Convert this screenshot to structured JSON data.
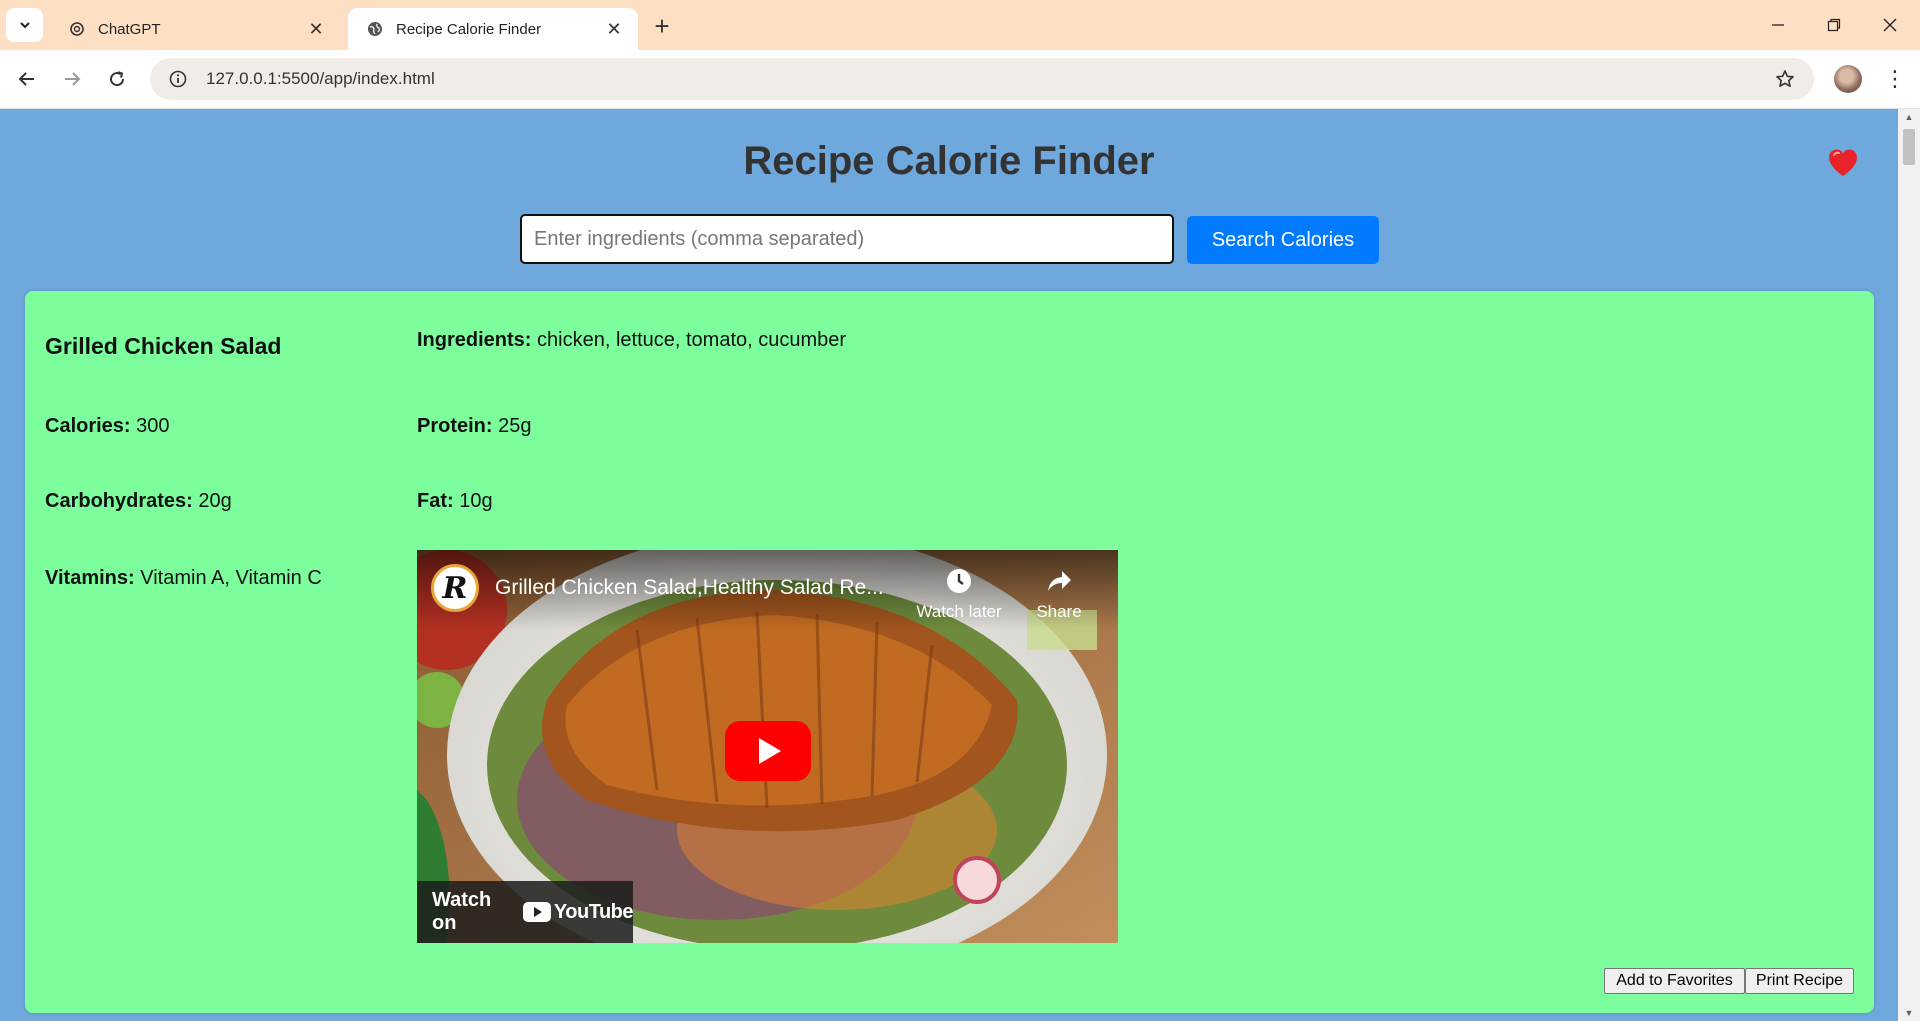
{
  "browser": {
    "tabs": [
      {
        "title": "ChatGPT",
        "active": false
      },
      {
        "title": "Recipe Calorie Finder",
        "active": true
      }
    ],
    "url": "127.0.0.1:5500/app/index.html"
  },
  "page": {
    "title": "Recipe Calorie Finder",
    "search": {
      "placeholder": "Enter ingredients (comma separated)",
      "value": "",
      "button_label": "Search Calories"
    }
  },
  "recipe": {
    "name": "Grilled Chicken Salad",
    "ingredients_label": "Ingredients:",
    "ingredients": "chicken, lettuce, tomato, cucumber",
    "calories_label": "Calories:",
    "calories": "300",
    "protein_label": "Protein:",
    "protein": "25g",
    "carbs_label": "Carbohydrates:",
    "carbs": "20g",
    "fat_label": "Fat:",
    "fat": "10g",
    "vitamins_label": "Vitamins:",
    "vitamins": "Vitamin A, Vitamin C",
    "video": {
      "title": "Grilled Chicken Salad,Healthy Salad Re...",
      "channel_initial": "R",
      "watch_later": "Watch later",
      "share": "Share",
      "watch_on": "Watch on",
      "youtube": "YouTube"
    },
    "actions": {
      "favorites": "Add to Favorites",
      "print": "Print Recipe"
    }
  },
  "colors": {
    "page_bg": "#6fa8dc",
    "card_bg": "#7cfe9d",
    "primary": "#007bff",
    "heart": "#e8232a"
  }
}
